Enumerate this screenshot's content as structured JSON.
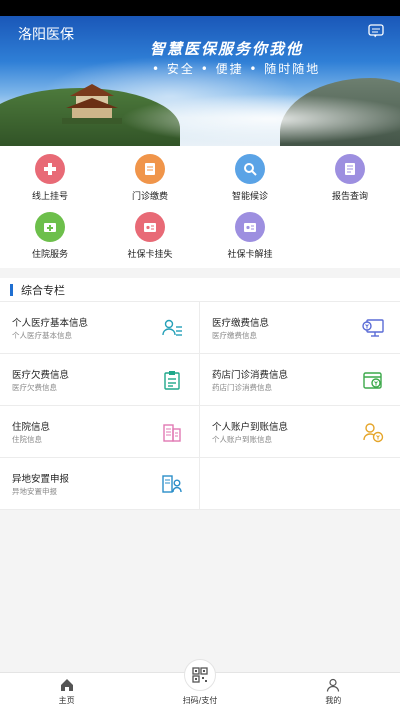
{
  "header": {
    "title": "洛阳医保",
    "slogan": "智慧医保服务你我他",
    "sub_slogan": "• 安全 • 便捷 • 随时随地"
  },
  "services": [
    {
      "label": "线上挂号",
      "color": "#e86a76",
      "icon": "medical-cross-icon"
    },
    {
      "label": "门诊缴费",
      "color": "#f0954a",
      "icon": "bill-icon"
    },
    {
      "label": "智能候诊",
      "color": "#5aa3e6",
      "icon": "queue-search-icon"
    },
    {
      "label": "报告查询",
      "color": "#9d8fe0",
      "icon": "report-icon"
    },
    {
      "label": "住院服务",
      "color": "#6dbf4b",
      "icon": "hospital-card-icon"
    },
    {
      "label": "社保卡挂失",
      "color": "#e86a76",
      "icon": "card-lost-icon"
    },
    {
      "label": "社保卡解挂",
      "color": "#9d8fe0",
      "icon": "card-unlock-icon"
    }
  ],
  "section": {
    "title": "综合专栏"
  },
  "info_items": [
    {
      "title": "个人医疗基本信息",
      "subtitle": "个人医疗基本信息",
      "icon": "person-list-icon",
      "color": "#25a0b8"
    },
    {
      "title": "医疗缴费信息",
      "subtitle": "医疗缴费信息",
      "icon": "monitor-payment-icon",
      "color": "#5a6bd6"
    },
    {
      "title": "医疗欠费信息",
      "subtitle": "医疗欠费信息",
      "icon": "clipboard-icon",
      "color": "#1fa78a"
    },
    {
      "title": "药店门诊消费信息",
      "subtitle": "药店门诊消费信息",
      "icon": "wallet-icon",
      "color": "#3ca94a"
    },
    {
      "title": "住院信息",
      "subtitle": "住院信息",
      "icon": "building-icon",
      "color": "#e079b3"
    },
    {
      "title": "个人账户到账信息",
      "subtitle": "个人账户到账信息",
      "icon": "person-coin-icon",
      "color": "#e5a52a"
    },
    {
      "title": "异地安置申报",
      "subtitle": "异地安置申报",
      "icon": "relocation-icon",
      "color": "#2b8ec9"
    }
  ],
  "bottom_nav": {
    "home": "主页",
    "scan": "扫码/支付",
    "mine": "我的"
  }
}
